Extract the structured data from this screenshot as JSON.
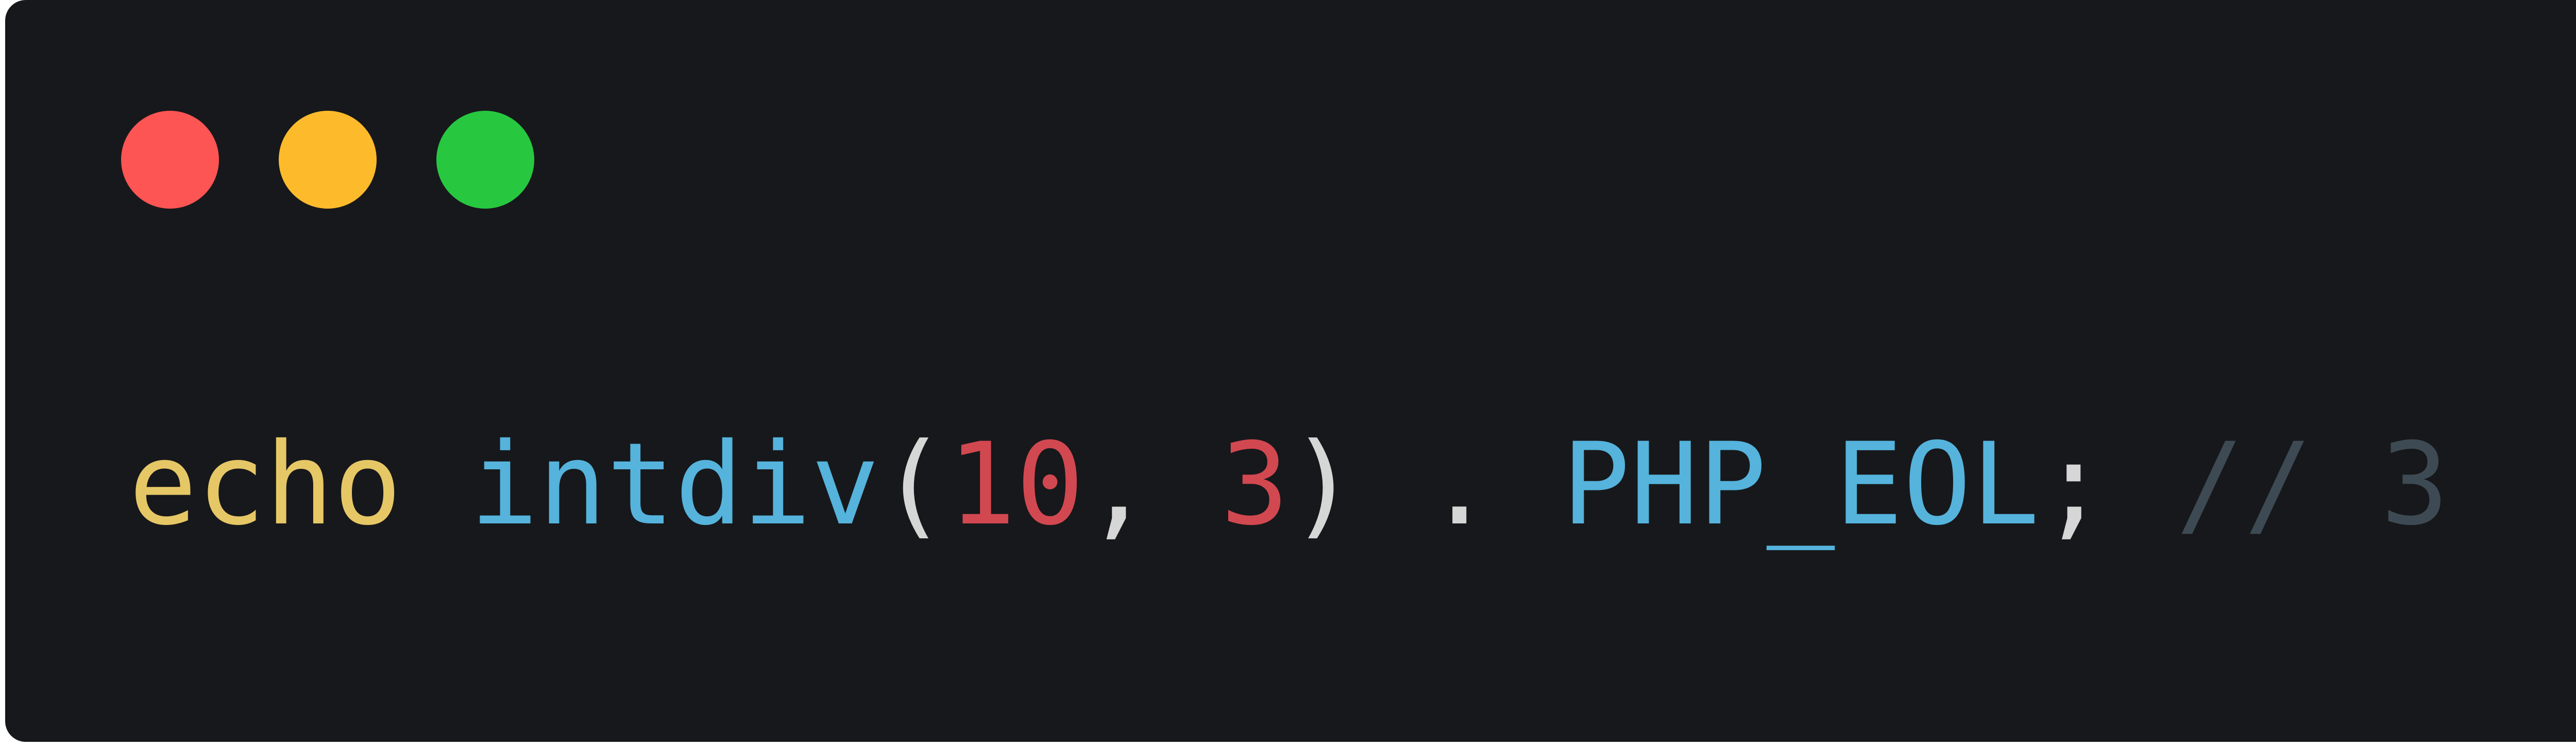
{
  "window": {
    "controls": [
      {
        "name": "close",
        "color": "#fd5454"
      },
      {
        "name": "minimize",
        "color": "#fdbb2c"
      },
      {
        "name": "maximize",
        "color": "#27c840"
      }
    ]
  },
  "code": {
    "tokens": [
      {
        "text": "echo",
        "color": "#e6c766",
        "role": "keyword"
      },
      {
        "text": " ",
        "color": "#d6d6d6",
        "role": "space"
      },
      {
        "text": "intdiv",
        "color": "#55b3dc",
        "role": "function"
      },
      {
        "text": "(",
        "color": "#d6d6d6",
        "role": "punctuation"
      },
      {
        "text": "10",
        "color": "#d24850",
        "role": "number"
      },
      {
        "text": ", ",
        "color": "#d6d6d6",
        "role": "punctuation"
      },
      {
        "text": "3",
        "color": "#d24850",
        "role": "number"
      },
      {
        "text": ") . ",
        "color": "#d6d6d6",
        "role": "punctuation"
      },
      {
        "text": "PHP_EOL",
        "color": "#55b3dc",
        "role": "constant"
      },
      {
        "text": "; ",
        "color": "#d6d6d6",
        "role": "punctuation"
      },
      {
        "text": "// 3",
        "color": "#3d4a53",
        "role": "comment"
      }
    ]
  }
}
